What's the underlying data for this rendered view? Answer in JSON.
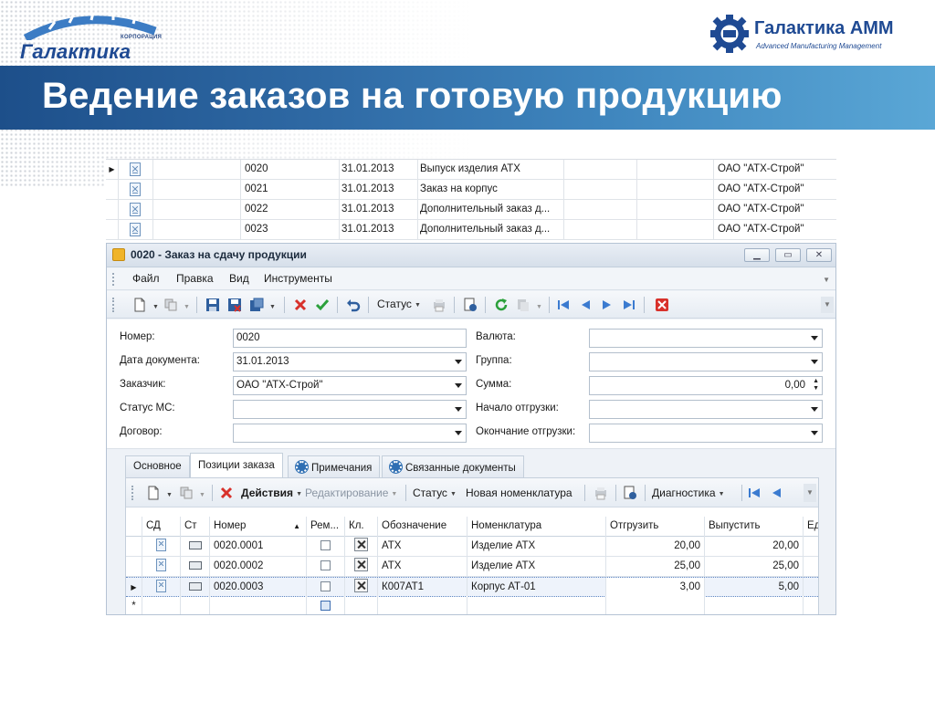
{
  "header": {
    "left_logo_corp": "КОРПОРАЦИЯ",
    "left_logo_name": "Галактика",
    "right_logo_name": "Галактика АММ",
    "right_logo_sub": "Advanced Manufacturing Management",
    "slide_title": "Ведение заказов на готовую продукцию"
  },
  "background_list": {
    "rows": [
      {
        "number": "0020",
        "date": "31.01.2013",
        "description": "Выпуск изделия АТХ",
        "customer": "ОАО \"АТХ-Строй\"",
        "current": true
      },
      {
        "number": "0021",
        "date": "31.01.2013",
        "description": "Заказ на корпус",
        "customer": "ОАО \"АТХ-Строй\"",
        "current": false
      },
      {
        "number": "0022",
        "date": "31.01.2013",
        "description": "Дополнительный заказ д...",
        "customer": "ОАО \"АТХ-Строй\"",
        "current": false
      },
      {
        "number": "0023",
        "date": "31.01.2013",
        "description": "Дополнительный заказ д...",
        "customer": "ОАО \"АТХ-Строй\"",
        "current": false
      }
    ]
  },
  "window": {
    "title": "0020 - Заказ на сдачу продукции",
    "menu": [
      "Файл",
      "Правка",
      "Вид",
      "Инструменты"
    ],
    "toolbar_status": "Статус"
  },
  "form": {
    "number_label": "Номер:",
    "number_value": "0020",
    "date_label": "Дата документа:",
    "date_value": "31.01.2013",
    "customer_label": "Заказчик:",
    "customer_value": "ОАО \"АТХ-Строй\"",
    "ms_status_label": "Статус МС:",
    "ms_status_value": "",
    "contract_label": "Договор:",
    "contract_value": "",
    "currency_label": "Валюта:",
    "currency_value": "",
    "group_label": "Группа:",
    "group_value": "",
    "sum_label": "Сумма:",
    "sum_value": "0,00",
    "ship_start_label": "Начало отгрузки:",
    "ship_start_value": "",
    "ship_end_label": "Окончание отгрузки:",
    "ship_end_value": ""
  },
  "tabs": [
    {
      "label": "Основное",
      "active": false
    },
    {
      "label": "Позиции заказа",
      "active": true
    },
    {
      "label": "Примечания",
      "active": false
    },
    {
      "label": "Связанные документы",
      "active": false
    }
  ],
  "positions_toolbar": {
    "actions": "Действия",
    "editing": "Редактирование",
    "status": "Статус",
    "new_nomenclature": "Новая номенклатура",
    "diagnostics": "Диагностика"
  },
  "positions_grid": {
    "columns": [
      "СД",
      "Ст",
      "Номер",
      "Рем...",
      "Кл.",
      "Обозначение",
      "Номенклатура",
      "Отгрузить",
      "Выпустить",
      "Ед"
    ],
    "rows": [
      {
        "number": "0020.0001",
        "designation": "АТХ",
        "nomenclature": "Изделие АТХ",
        "ship": "20,00",
        "release": "20,00",
        "selected": false
      },
      {
        "number": "0020.0002",
        "designation": "АТХ",
        "nomenclature": "Изделие АТХ",
        "ship": "25,00",
        "release": "25,00",
        "selected": false
      },
      {
        "number": "0020.0003",
        "designation": "К007АТ1",
        "nomenclature": "Корпус АТ-01",
        "ship": "3,00",
        "release": "5,00",
        "selected": true
      }
    ],
    "new_row_marker": "*"
  },
  "colors": {
    "band_start": "#1d4f8a",
    "band_end": "#5aa7d6",
    "brand_blue": "#1f4a93",
    "delete_red": "#d8312b",
    "ok_green": "#2ba03b"
  }
}
